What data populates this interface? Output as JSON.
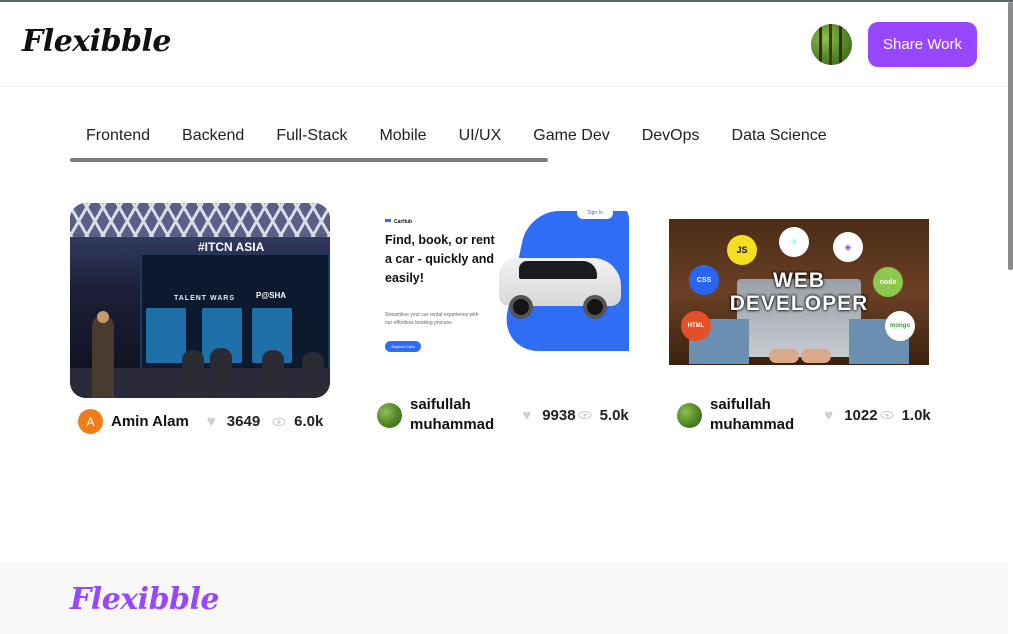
{
  "brand": {
    "logo_text": "Flexibble",
    "accent_color": "#9747ff"
  },
  "header": {
    "share_label": "Share Work",
    "avatar_icon": "user-avatar-forest"
  },
  "categories": [
    "Frontend",
    "Backend",
    "Full-Stack",
    "Mobile",
    "UI/UX",
    "Game Dev",
    "DevOps",
    "Data Science"
  ],
  "projects": [
    {
      "author": {
        "name": "Amin Alam",
        "initial": "A",
        "avatar_color": "#f07c1a"
      },
      "likes": "3649",
      "views": "6.0k",
      "image": {
        "brand": "#ITCN ASIA",
        "event": "TALENT WARS",
        "partner": "P@SHA"
      }
    },
    {
      "author": {
        "name_line1": "saifullah",
        "name_line2": "muhammad"
      },
      "likes": "9938",
      "views": "5.0k",
      "image": {
        "app_name": "CarHub",
        "sign_in": "Sign In",
        "headline": "Find, book, or rent a car - quickly and easily!",
        "subtext": "Streamline your car rental experience with our effortless booking process.",
        "cta": "Explore Cars"
      }
    },
    {
      "author": {
        "name_line1": "saifullah",
        "name_line2": "muhammad"
      },
      "likes": "1022",
      "views": "1.0k",
      "image": {
        "title_line1": "WEB",
        "title_line2": "DEVELOPER",
        "logos": [
          "JS",
          "CSS",
          "HTML",
          "node",
          "mongo"
        ]
      }
    }
  ],
  "footer": {
    "logo_text": "Flexibble"
  }
}
